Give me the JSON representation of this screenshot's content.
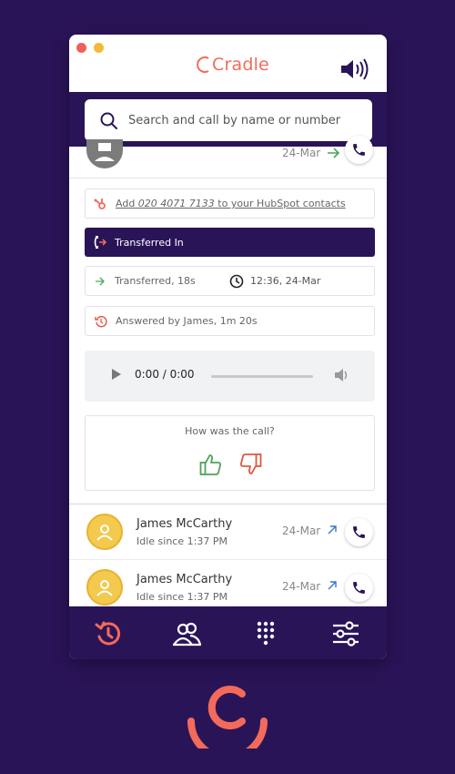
{
  "app": {
    "brand": "Cradle",
    "colors": {
      "accent": "#f36a5a",
      "navy": "#2a1458",
      "thumb_up": "#4fa35a",
      "thumb_down": "#e0573f",
      "link_arrow": "#3a74c9",
      "avatar_yellow": "#f3c94e"
    }
  },
  "titlebar": {
    "window_controls": [
      "close",
      "minimize"
    ],
    "speaker_icon": "speaker-volume-icon"
  },
  "search": {
    "placeholder": "Search and call by name or number"
  },
  "call_detail": {
    "top_date": "24-Mar",
    "hubspot": {
      "prefix": "Add",
      "number": "020 4071 7133",
      "suffix": "to your HubSpot contacts"
    },
    "transfer_banner": "Transferred In",
    "transferred": "Transferred, 18s",
    "time": "12:36, 24-Mar",
    "answered": "Answered by James, 1m 20s",
    "audio": {
      "time": "0:00 / 0:00",
      "progress": 0
    },
    "feedback": {
      "question": "How was the call?"
    }
  },
  "recent_calls": [
    {
      "name": "James McCarthy",
      "status": "Idle since 1:37 PM",
      "date": "24-Mar",
      "direction": "outgoing"
    },
    {
      "name": "James McCarthy",
      "status": "Idle since 1:37 PM",
      "date": "24-Mar",
      "direction": "outgoing"
    }
  ],
  "bottom_nav": {
    "items": [
      "history-icon",
      "contacts-icon",
      "dialpad-icon",
      "settings-sliders-icon"
    ],
    "active": "history-icon"
  }
}
